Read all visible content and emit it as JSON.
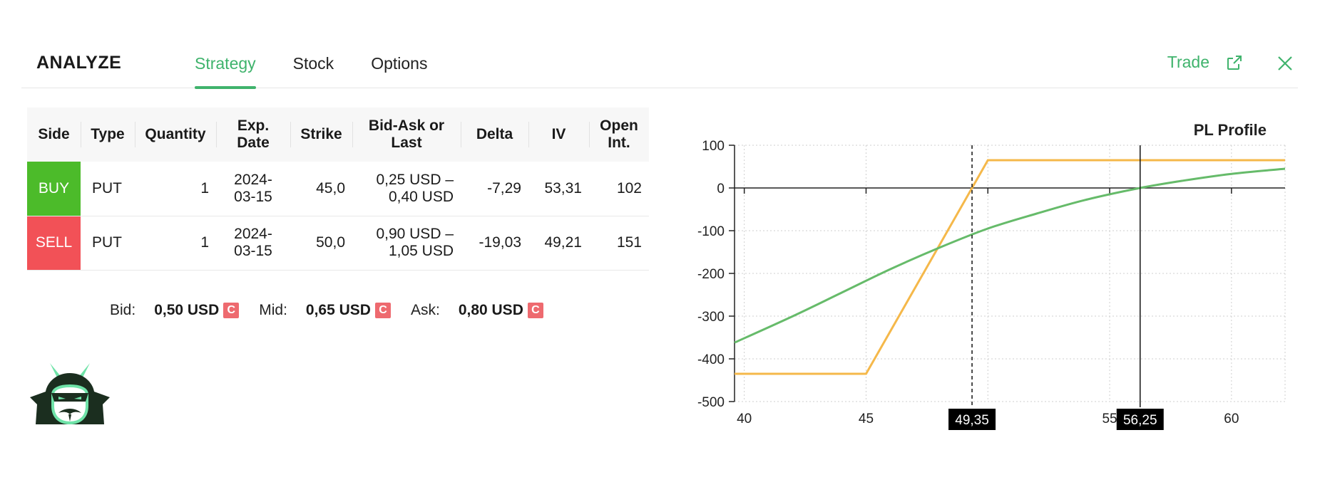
{
  "header": {
    "brand": "ANALYZE",
    "tabs": [
      {
        "label": "Strategy",
        "active": true
      },
      {
        "label": "Stock",
        "active": false
      },
      {
        "label": "Options",
        "active": false
      }
    ],
    "trade_label": "Trade",
    "accent_color": "#3fb36c"
  },
  "table": {
    "headers": [
      "Side",
      "Type",
      "Quantity",
      "Exp. Date",
      "Strike",
      "Bid-Ask or Last",
      "Delta",
      "IV",
      "Open Int."
    ],
    "header_lines": [
      [
        "Side"
      ],
      [
        "Type"
      ],
      [
        "Quantity"
      ],
      [
        "Exp.",
        "Date"
      ],
      [
        "Strike"
      ],
      [
        "Bid-Ask or",
        "Last"
      ],
      [
        "Delta"
      ],
      [
        "IV"
      ],
      [
        "Open",
        "Int."
      ]
    ],
    "rows": [
      {
        "side": "BUY",
        "side_color": "#4cbb2a",
        "type": "PUT",
        "quantity": "1",
        "exp_line1": "2024-",
        "exp_line2": "03-15",
        "strike": "45,0",
        "bidask_line1": "0,25 USD –",
        "bidask_line2": "0,40 USD",
        "delta": "-7,29",
        "iv": "53,31",
        "open_int": "102"
      },
      {
        "side": "SELL",
        "side_color": "#f25157",
        "type": "PUT",
        "quantity": "1",
        "exp_line1": "2024-",
        "exp_line2": "03-15",
        "strike": "50,0",
        "bidask_line1": "0,90 USD –",
        "bidask_line2": "1,05 USD",
        "delta": "-19,03",
        "iv": "49,21",
        "open_int": "151"
      }
    ]
  },
  "quotes": {
    "bid_label": "Bid:",
    "bid_value": "0,50 USD",
    "mid_label": "Mid:",
    "mid_value": "0,65 USD",
    "ask_label": "Ask:",
    "ask_value": "0,80 USD",
    "badge": "C"
  },
  "chart_data": {
    "type": "line",
    "title": "PL Profile",
    "xlim": [
      39.6,
      62.2
    ],
    "ylim": [
      -500,
      100
    ],
    "xticks": [
      40,
      45,
      50,
      55,
      60
    ],
    "xtick_labels": [
      "40",
      "45",
      "",
      "55",
      "60"
    ],
    "yticks": [
      100,
      0,
      -100,
      -200,
      -300,
      -400,
      -500
    ],
    "grid": true,
    "series": [
      {
        "color": "#f5b84a",
        "x": [
          39.6,
          45.0,
          50.0,
          62.2
        ],
        "y": [
          -435,
          -435,
          65,
          65
        ]
      },
      {
        "color": "#66bb6a",
        "x": [
          39.6,
          42.0,
          44.0,
          46.0,
          48.0,
          50.0,
          52.0,
          54.0,
          56.25,
          58.0,
          60.0,
          62.2
        ],
        "y": [
          -362,
          -300,
          -245,
          -190,
          -140,
          -95,
          -60,
          -28,
          0,
          17,
          33,
          45
        ]
      }
    ],
    "markers": [
      {
        "x": 49.35,
        "label": "49,35",
        "style": "dashed"
      },
      {
        "x": 56.25,
        "label": "56,25",
        "style": "solid"
      }
    ]
  }
}
